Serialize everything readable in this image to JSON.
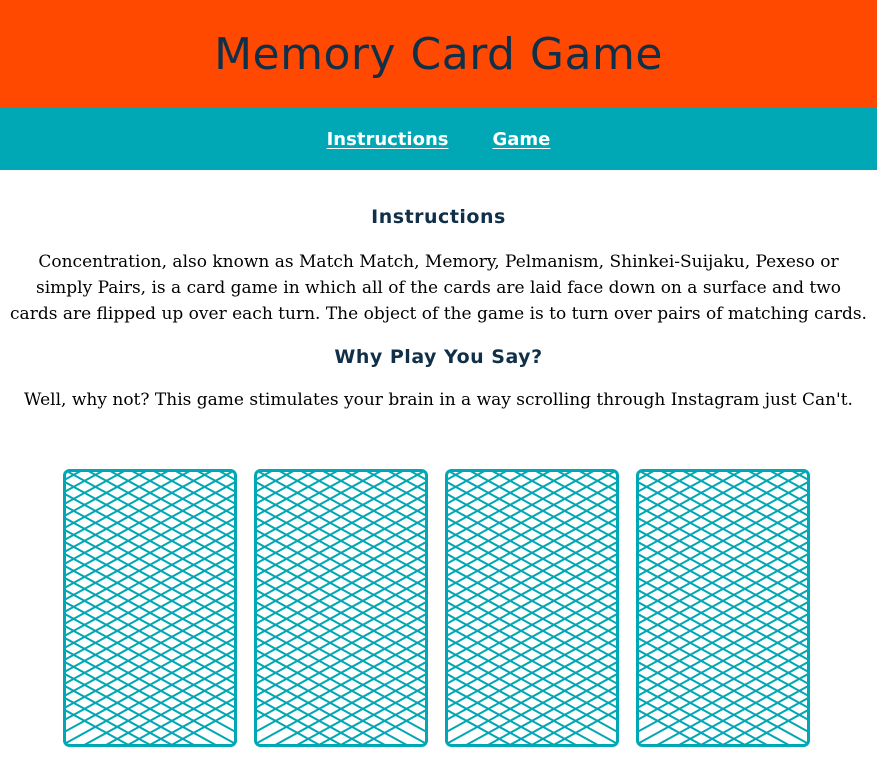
{
  "header": {
    "title": "Memory Card Game"
  },
  "nav": {
    "items": [
      {
        "label": "Instructions"
      },
      {
        "label": "Game"
      }
    ]
  },
  "instructions": {
    "heading": "Instructions",
    "body": "Concentration, also known as Match Match, Memory, Pelmanism, Shinkei-Suijaku, Pexeso or simply Pairs, is a card game in which all of the cards are laid face down on a surface and two cards are flipped up over each turn. The object of the game is to turn over pairs of matching cards."
  },
  "why": {
    "heading": "Why Play You Say?",
    "body": "Well, why not? This game stimulates your brain in a way scrolling through Instagram just Can't."
  },
  "cards": [
    {
      "face": "card-back-icon"
    },
    {
      "face": "card-back-icon"
    },
    {
      "face": "card-back-icon"
    },
    {
      "face": "card-back-icon"
    }
  ],
  "colors": {
    "header_bg": "#ff4800",
    "nav_bg": "#00a7b4",
    "card_stroke": "#00a7b4",
    "heading_text": "#10304a"
  }
}
